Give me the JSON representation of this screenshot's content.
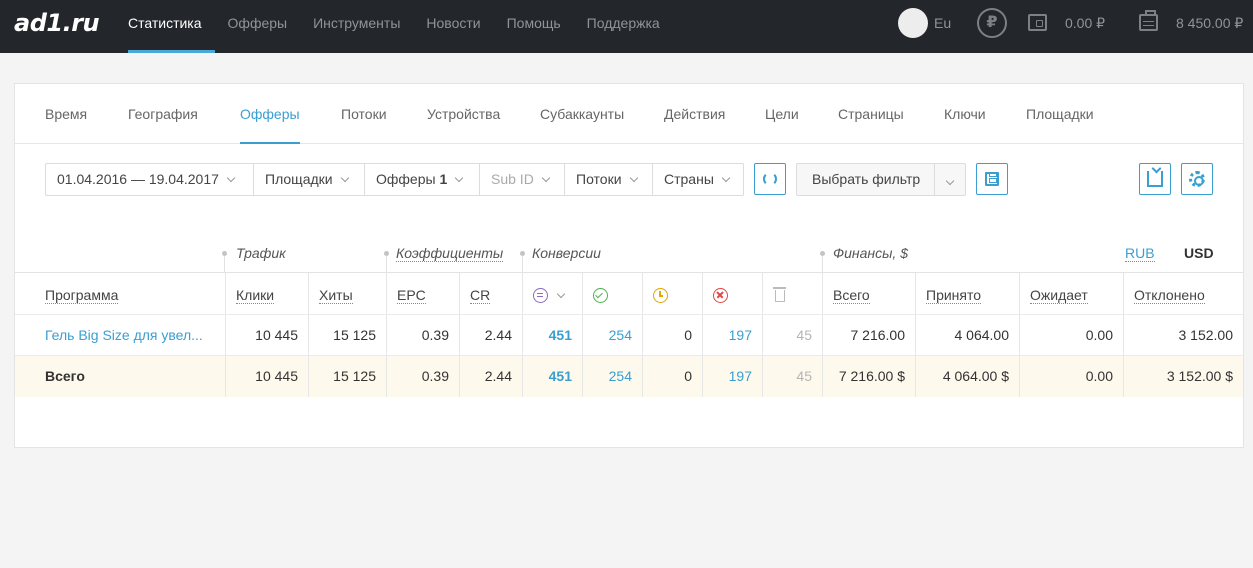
{
  "logo": "ad1.ru",
  "nav": [
    "Статистика",
    "Офферы",
    "Инструменты",
    "Новости",
    "Помощь",
    "Поддержка"
  ],
  "lang": "Eu",
  "wallet": "0.00 ₽",
  "balance": "8 450.00 ₽",
  "ruble_symbol": "₽",
  "tabs": [
    "Время",
    "География",
    "Офферы",
    "Потоки",
    "Устройства",
    "Субаккаунты",
    "Действия",
    "Цели",
    "Страницы",
    "Ключи",
    "Площадки"
  ],
  "filters": {
    "date": "01.04.2016 — 19.04.2017",
    "sites": "Площадки",
    "offers": "Офферы",
    "offers_count": "1",
    "subid": "Sub ID",
    "streams": "Потоки",
    "countries": "Страны",
    "choose": "Выбрать фильтр"
  },
  "groups": {
    "traffic": "Трафик",
    "coef": "Коэффициенты",
    "conv": "Конверсии",
    "finance": "Финансы, $",
    "rub": "RUB",
    "usd": "USD"
  },
  "columns": {
    "program": "Программа",
    "clicks": "Клики",
    "hits": "Хиты",
    "epc": "EPC",
    "cr": "CR",
    "total": "Всего",
    "accepted": "Принято",
    "pending": "Ожидает",
    "rejected": "Отклонено"
  },
  "rows": [
    {
      "program": "Гель Big Size для увел...",
      "clicks": "10 445",
      "hits": "15 125",
      "epc": "0.39",
      "cr": "2.44",
      "all": "451",
      "ok": "254",
      "wait": "0",
      "rej": "197",
      "trash": "45",
      "f_total": "7 216.00",
      "f_accepted": "4 064.00",
      "f_pending": "0.00",
      "f_rejected": "3 152.00"
    }
  ],
  "totals": {
    "program": "Всего",
    "clicks": "10 445",
    "hits": "15 125",
    "epc": "0.39",
    "cr": "2.44",
    "all": "451",
    "ok": "254",
    "wait": "0",
    "rej": "197",
    "trash": "45",
    "f_total": "7 216.00 $",
    "f_accepted": "4 064.00 $",
    "f_pending": "0.00",
    "f_rejected": "3 152.00 $"
  }
}
